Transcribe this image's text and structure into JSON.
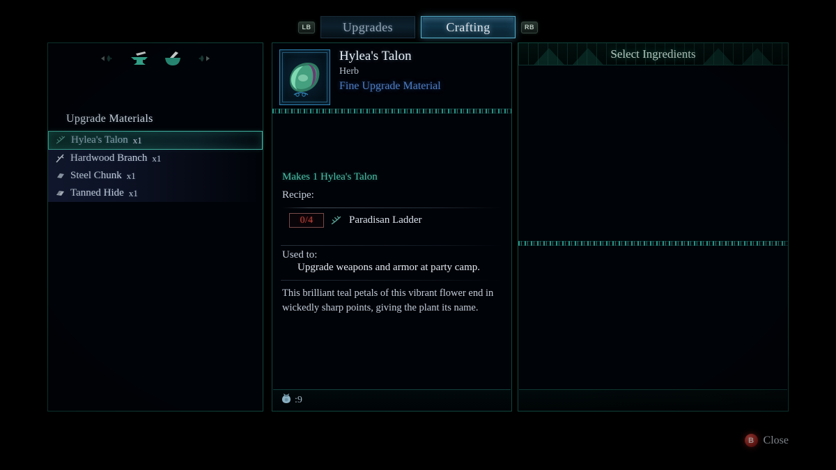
{
  "tabs": {
    "left_shoulder": "LB",
    "right_shoulder": "RB",
    "items": [
      {
        "label": "Upgrades",
        "active": false
      },
      {
        "label": "Crafting",
        "active": true
      }
    ]
  },
  "left_panel": {
    "category_icons": [
      "left-arrow-icon",
      "anvil-icon",
      "mortar-pestle-icon",
      "right-arrow-icon"
    ],
    "title": "Upgrade Materials",
    "materials": [
      {
        "icon": "herb-sprig-icon",
        "name": "Hylea's Talon",
        "qty": "x1",
        "selected": true
      },
      {
        "icon": "branch-icon",
        "name": "Hardwood Branch",
        "qty": "x1",
        "selected": false
      },
      {
        "icon": "metal-chunk-icon",
        "name": "Steel Chunk",
        "qty": "x1",
        "selected": false
      },
      {
        "icon": "hide-icon",
        "name": "Tanned Hide",
        "qty": "x1",
        "selected": false
      }
    ]
  },
  "detail": {
    "item_icon": "hyleas-talon-thumbnail",
    "name": "Hylea's Talon",
    "type": "Herb",
    "grade": "Fine Upgrade Material",
    "makes": "Makes 1 Hylea's Talon",
    "recipe_label": "Recipe:",
    "recipe": [
      {
        "count": "0/4",
        "icon": "herb-sprig-icon",
        "name": "Paradisan Ladder"
      }
    ],
    "used_to_label": "Used to:",
    "used_to_text": "Upgrade weapons and armor at party camp.",
    "description": "This brilliant teal petals of this vibrant flower end in wickedly sharp points, giving the plant its name.",
    "footer": {
      "icon": "coin-pouch-icon",
      "value": ":9"
    }
  },
  "right_panel": {
    "title": "Select Ingredients"
  },
  "footer": {
    "close_button_glyph": "B",
    "close_label": "Close"
  },
  "colors": {
    "accent_teal": "#3fae9c",
    "accent_blue": "#5fb9d8",
    "grade_blue": "#4f7dc4",
    "warning_red": "#c0433a",
    "background": "#000000"
  }
}
